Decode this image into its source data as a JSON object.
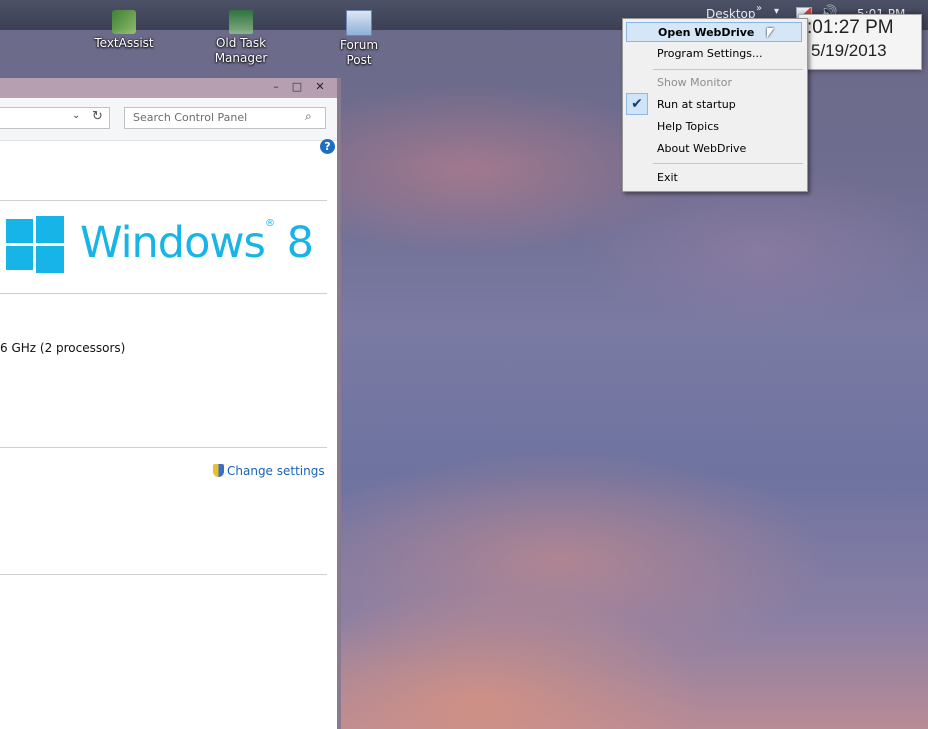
{
  "taskbar": {
    "toolbar_label": "Desktop",
    "chevron": "»",
    "dropdown": "▾",
    "tray_icons": [
      "webdrive-tray-icon",
      "volume-icon"
    ],
    "time": "5:01 PM"
  },
  "desktop_icons": [
    {
      "label": "TextAssist",
      "icon": "textassist-icon"
    },
    {
      "label": "Old Task\nManager",
      "icon": "task-manager-icon"
    },
    {
      "label": "Forum\nPost",
      "icon": "document-icon"
    }
  ],
  "clock_gadget": {
    "time": ":01:27 PM",
    "date": "5/19/2013"
  },
  "context_menu": {
    "items": [
      {
        "label": "Open WebDrive",
        "bold": true,
        "hover": true
      },
      {
        "label": "Program Settings..."
      },
      {
        "label": "Show Monitor",
        "disabled": true
      },
      {
        "label": "Run at startup",
        "checked": true
      },
      {
        "label": "Help Topics"
      },
      {
        "label": "About WebDrive"
      },
      {
        "label": "Exit"
      }
    ]
  },
  "control_panel": {
    "window_controls": {
      "minimize": "–",
      "maximize": "□",
      "close": "✕"
    },
    "address_dropdown": "⌄",
    "refresh": "↻",
    "search_placeholder": "Search Control Panel",
    "search_icon": "⌕",
    "help": "?",
    "brand": "Windows",
    "brand_version": "8",
    "processor_text": "6 GHz  (2 processors)",
    "change_settings": "Change settings"
  },
  "colors": {
    "accent": "#17b4e8",
    "link": "#1a63b5",
    "menu_hover": "#d5e6f7"
  }
}
